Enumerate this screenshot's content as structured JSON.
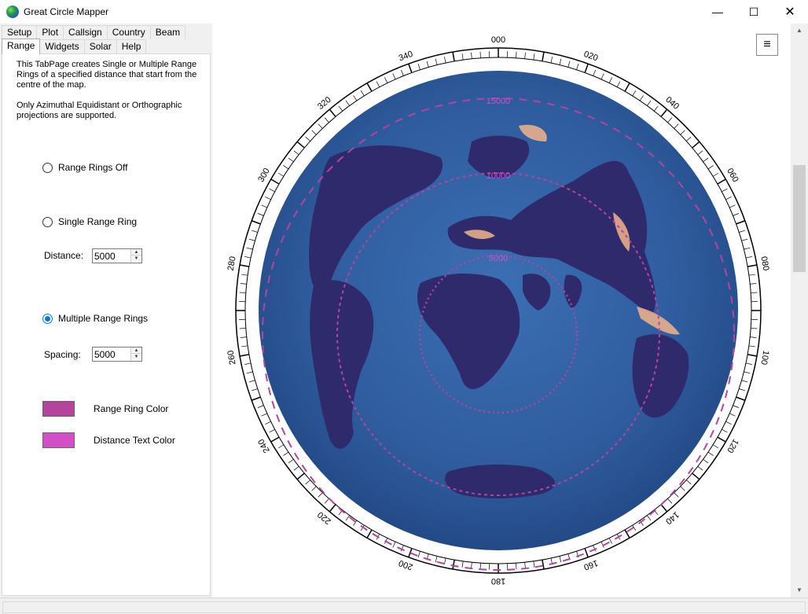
{
  "window": {
    "title": "Great Circle Mapper",
    "minimize_glyph": "—",
    "maximize_glyph": "☐",
    "close_glyph": "✕"
  },
  "tabs": {
    "row1": [
      "Setup",
      "Plot",
      "Callsign",
      "Country",
      "Beam"
    ],
    "row2": [
      "Range",
      "Widgets",
      "Solar",
      "Help"
    ],
    "active": "Range"
  },
  "range_page": {
    "description": "This TabPage creates Single or Multiple Range Rings of a specified distance that start from the centre of the map.",
    "note": "Only Azimuthal Equidistant or Orthographic projections are supported.",
    "radio_off_label": "Range Rings Off",
    "radio_single_label": "Single Range Ring",
    "radio_multi_label": "Multiple Range Rings",
    "selected_mode": "multiple",
    "distance_label": "Distance:",
    "distance_value": "5000",
    "spacing_label": "Spacing:",
    "spacing_value": "5000",
    "ring_color_label": "Range Ring Color",
    "ring_color": "#b5449e",
    "text_color_label": "Distance Text Color",
    "text_color": "#d34fc8"
  },
  "map": {
    "menu_glyph": "≡",
    "bearing_labels": [
      "000",
      "020",
      "040",
      "060",
      "080",
      "100",
      "120",
      "140",
      "160",
      "180",
      "200",
      "220",
      "240",
      "260",
      "280",
      "300",
      "320",
      "340"
    ],
    "ring_labels": [
      "5000",
      "10000",
      "15000"
    ],
    "ocean_color": "#2f5c9e",
    "land_color": "#2e2a6b",
    "coast_color": "#f2b48a"
  }
}
